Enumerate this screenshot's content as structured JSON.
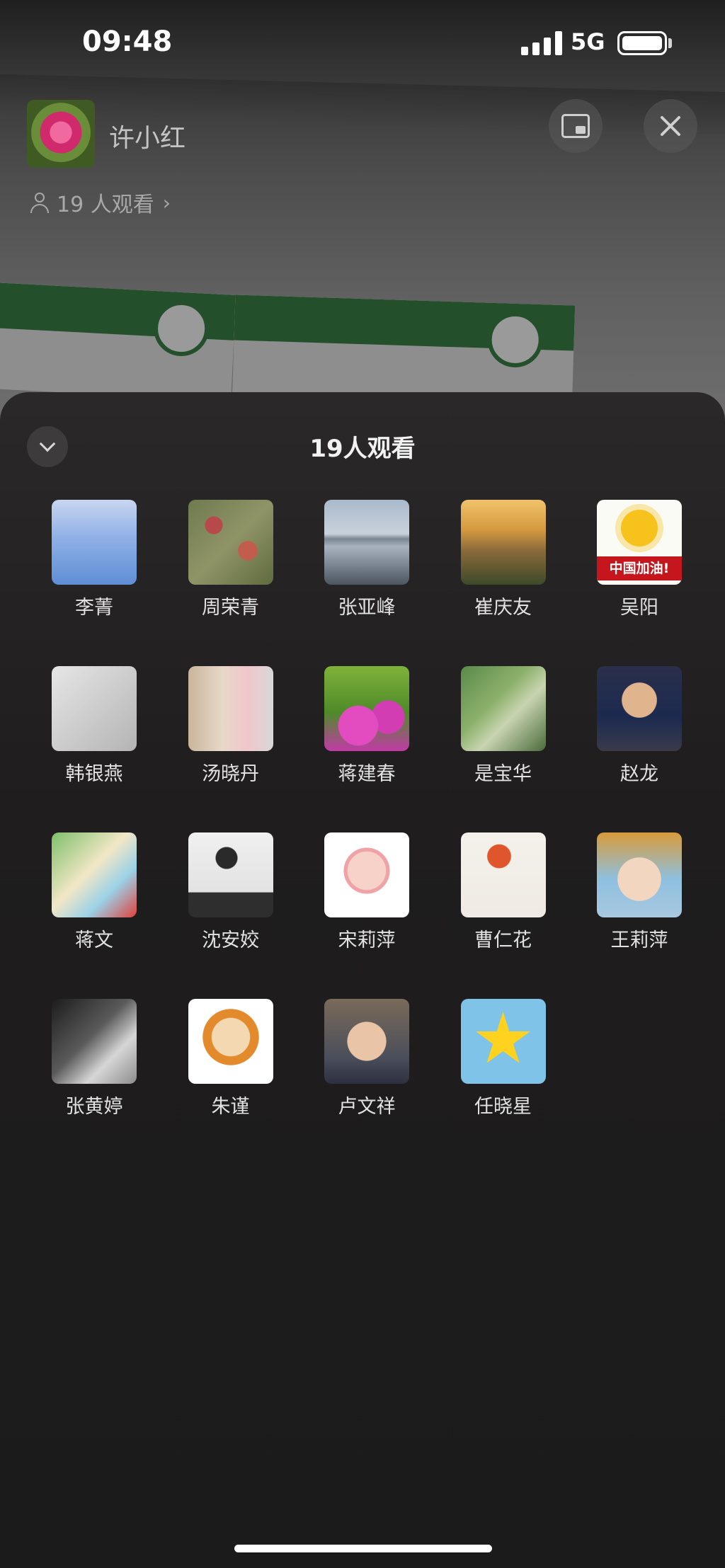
{
  "status_bar": {
    "time": "09:48",
    "network": "5G"
  },
  "header": {
    "host_name": "许小红",
    "viewers_text": "19 人观看",
    "chevron": "›"
  },
  "sheet": {
    "title": "19人观看",
    "viewers": [
      {
        "name": "李菁",
        "avatar": {
          "type": "photo",
          "bg": "linear-gradient(180deg,#c9d6f0 0%,#8fb0e6 45%,#5f8ed6 100%)",
          "accent": "#2d2d3a"
        }
      },
      {
        "name": "周荣青",
        "avatar": {
          "type": "photo",
          "bg": "radial-gradient(circle at 30% 30%,#b8494a 0 10%,transparent 11%),radial-gradient(circle at 70% 60%,#c25c4c 0 12%,transparent 13%),linear-gradient(135deg,#6e7a4e,#8f9467 50%,#5f6b3e)"
        }
      },
      {
        "name": "张亚峰",
        "avatar": {
          "type": "photo",
          "bg": "linear-gradient(180deg,#a9b9cc 0%,#c9d2db 40%,#7b8694 46%,#a8b3bf 55%,#4c5560 100%)"
        }
      },
      {
        "name": "崔庆友",
        "avatar": {
          "type": "photo",
          "bg": "linear-gradient(180deg,#f0c26a 0%,#d59a3f 35%,#8a6a3a 60%,#3c4a2a 100%)"
        }
      },
      {
        "name": "吴阳",
        "avatar": {
          "type": "sun",
          "bg": "#fbfbf6",
          "sun": "#f6c21b",
          "banner": "#c4161c",
          "text": "中国加油!"
        }
      },
      {
        "name": "韩银燕",
        "avatar": {
          "type": "photo",
          "bg": "linear-gradient(135deg,#e6e6e6,#c8c8c8 60%,#b4b4b4)"
        }
      },
      {
        "name": "汤晓丹",
        "avatar": {
          "type": "photo",
          "bg": "linear-gradient(90deg,#c9b59a 0%,#e8d8c8 40%,#f0c6cb 70%,#d8d8d8 100%)"
        }
      },
      {
        "name": "蒋建春",
        "avatar": {
          "type": "photo",
          "bg": "radial-gradient(circle at 40% 70%,#e24cc0 0 25%,transparent 26%),radial-gradient(circle at 75% 60%,#d23db4 0 20%,transparent 21%),linear-gradient(180deg,#7fb23a,#4f8a2a 55%,#c23aa8)"
        }
      },
      {
        "name": "是宝华",
        "avatar": {
          "type": "photo",
          "bg": "linear-gradient(135deg,#5a8a4a,#8cb06c 40%,#c8d4b0 60%,#4a6a3a)"
        }
      },
      {
        "name": "赵龙",
        "avatar": {
          "type": "photo",
          "bg": "radial-gradient(circle at 50% 40%,#e0b48c 0 26%,transparent 27%),linear-gradient(180deg,#2a2f4a,#1c2a50 60%,#3a3a4a)"
        }
      },
      {
        "name": "蒋文",
        "avatar": {
          "type": "photo",
          "bg": "linear-gradient(135deg,#7fbf6a,#f2e7c7 45%,#9bd1e6 70%,#e0413a)"
        }
      },
      {
        "name": "沈安姣",
        "avatar": {
          "type": "photo",
          "bg": "radial-gradient(circle at 45% 30%,#2a2a2a 0 14%,transparent 15%),linear-gradient(180deg,#f0f0f0,#e2e2e2 70%,#2e2e2e 71%,#2e2e2e)"
        }
      },
      {
        "name": "宋莉萍",
        "avatar": {
          "type": "photo",
          "bg": "radial-gradient(circle at 50% 45%,#f6d2c8 0 30%,#f0a3a6 31% 36%,#ffffff 37%)"
        }
      },
      {
        "name": "曹仁花",
        "avatar": {
          "type": "photo",
          "bg": "radial-gradient(circle at 45% 28%,#e0562c 0 15%,transparent 16%),linear-gradient(180deg,#f4f1ec,#efeae3)"
        }
      },
      {
        "name": "王莉萍",
        "avatar": {
          "type": "photo",
          "bg": "radial-gradient(circle at 50% 55%,#f3d6c0 0 34%,transparent 35%),linear-gradient(180deg,#d89a3a,#8fc0e0 55%,#a8c8e0)"
        }
      },
      {
        "name": "张黄婷",
        "avatar": {
          "type": "photo",
          "bg": "linear-gradient(135deg,#1c1c1c,#5a5a5a 45%,#d6d6d6 70%,#8c8c8c)"
        }
      },
      {
        "name": "朱谨",
        "avatar": {
          "type": "photo",
          "bg": "radial-gradient(circle at 50% 45%,#f3d8b2 0 30%,#e28a2c 31% 44%,#ffffff 45%)"
        }
      },
      {
        "name": "卢文祥",
        "avatar": {
          "type": "photo",
          "bg": "radial-gradient(circle at 50% 50%,#e9c4a6 0 32%,transparent 33%),linear-gradient(180deg,#7a6a5a,#4a4e5a 70%,#2c3040)"
        }
      },
      {
        "name": "任晓星",
        "avatar": {
          "type": "star",
          "bg": "#7fc3e8",
          "star": "#ffd21f"
        }
      }
    ]
  },
  "colors": {
    "sheet_bg": "#1f1d1d",
    "text_primary": "#f2f2f2",
    "text_muted": "#a8a8a8",
    "banner_green": "#2d6f38"
  },
  "icons": {
    "collapse": "chevron-down-icon",
    "close": "close-icon",
    "float_window": "picture-in-picture-icon",
    "viewers": "person-icon"
  }
}
